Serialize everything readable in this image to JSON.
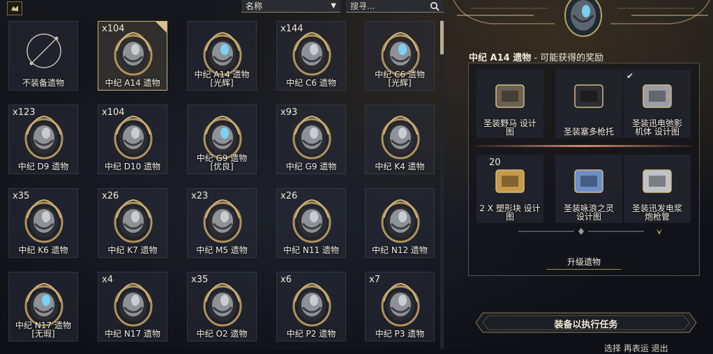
{
  "toolbar": {
    "sort_label": "名称",
    "search_placeholder": "搜寻..."
  },
  "relics": [
    {
      "name": "不装备遗物",
      "count": "",
      "kind": "none"
    },
    {
      "name": "中纪 A14 遗物",
      "count": "x104",
      "kind": "relic",
      "selected": true
    },
    {
      "name": "中纪 A14 遗物\n[光辉]",
      "count": "",
      "kind": "radiant"
    },
    {
      "name": "中纪 C6 遗物",
      "count": "x144",
      "kind": "relic"
    },
    {
      "name": "中纪 C6 遗物\n[光辉]",
      "count": "",
      "kind": "radiant"
    },
    {
      "name": "中纪 D9 遗物",
      "count": "x123",
      "kind": "relic"
    },
    {
      "name": "中纪 D10 遗物",
      "count": "x104",
      "kind": "relic"
    },
    {
      "name": "中纪 G9 遗物\n[优良]",
      "count": "",
      "kind": "radiant"
    },
    {
      "name": "中纪 G9 遗物",
      "count": "x93",
      "kind": "relic"
    },
    {
      "name": "中纪 K4 遗物",
      "count": "",
      "kind": "relic"
    },
    {
      "name": "中纪 K6 遗物",
      "count": "x35",
      "kind": "relic"
    },
    {
      "name": "中纪 K7 遗物",
      "count": "x26",
      "kind": "relic"
    },
    {
      "name": "中纪 M5 遗物",
      "count": "x23",
      "kind": "relic"
    },
    {
      "name": "中纪 N11 遗物",
      "count": "x26",
      "kind": "relic"
    },
    {
      "name": "中纪 N12 遗物",
      "count": "",
      "kind": "relic"
    },
    {
      "name": "中纪 N17 遗物\n[无瑕]",
      "count": "",
      "kind": "radiant"
    },
    {
      "name": "中纪 N17 遗物",
      "count": "x4",
      "kind": "relic"
    },
    {
      "name": "中纪 O2 遗物",
      "count": "x35",
      "kind": "relic"
    },
    {
      "name": "中纪 P2 遗物",
      "count": "x6",
      "kind": "relic"
    },
    {
      "name": "中纪 P3 遗物",
      "count": "x7",
      "kind": "relic"
    }
  ],
  "panel": {
    "relic_name": "中纪 A14 遗物",
    "title_suffix": " - 可能获得的奖励",
    "rewards": [
      {
        "name": "圣装野马 设计\n图",
        "badge": "",
        "owned": false
      },
      {
        "name": "圣装塞多枪托",
        "badge": "",
        "owned": false
      },
      {
        "name": "圣装迅电弛影\n机体 设计图",
        "badge": "",
        "owned": true
      },
      {
        "name": "2 X 塑形块 设计\n图",
        "badge": "20",
        "owned": false
      },
      {
        "name": "圣装咏浪之灵\n设计图",
        "badge": "",
        "owned": false
      },
      {
        "name": "圣装迅发电浆\n炮枪管",
        "badge": "",
        "owned": false
      }
    ],
    "upgrade_label": "升级遗物",
    "equip_label": "装备以执行任务"
  },
  "footer": {
    "hint_text": "选择 再表运   退出"
  },
  "colors": {
    "gold": "#c9b27a",
    "accent_divider": "#d48a6a"
  }
}
